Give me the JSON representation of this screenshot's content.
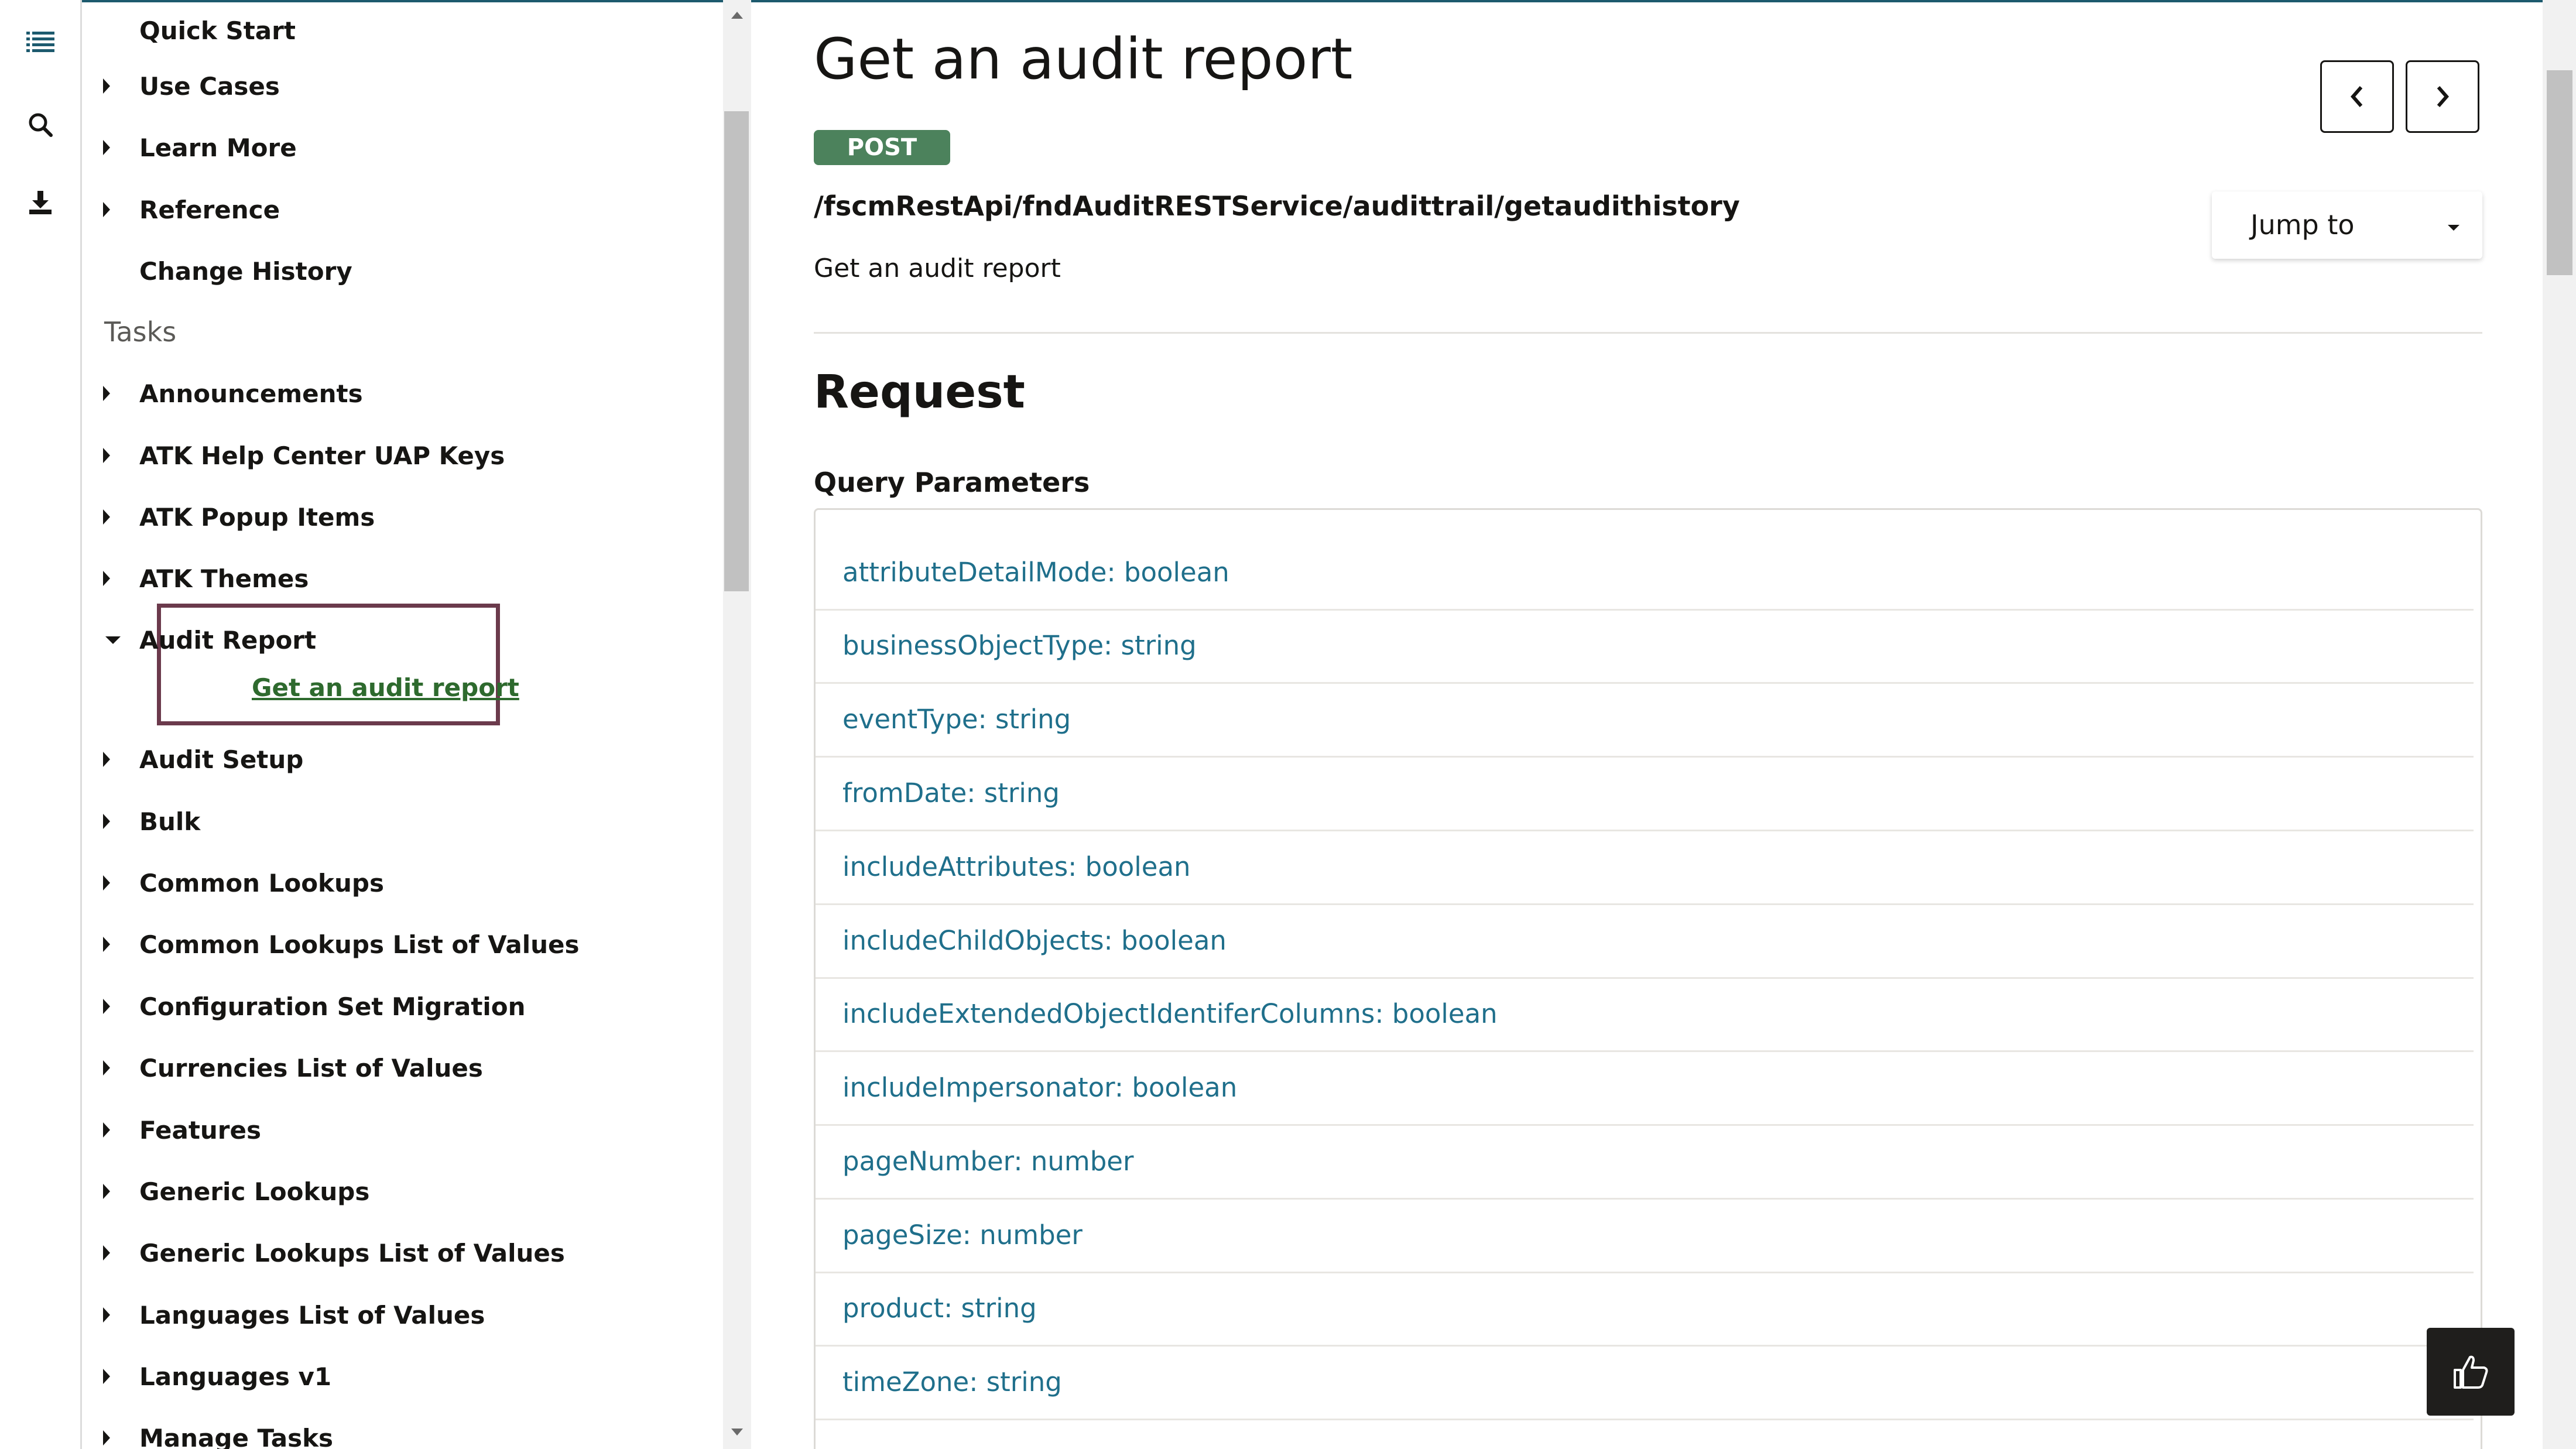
{
  "rail": {
    "icons": [
      "list-icon",
      "search-icon",
      "download-icon"
    ]
  },
  "sidebar": {
    "items_top": [
      {
        "label": "Quick Start",
        "expandable": false
      },
      {
        "label": "Use Cases",
        "expandable": true
      },
      {
        "label": "Learn More",
        "expandable": true
      },
      {
        "label": "Reference",
        "expandable": true
      },
      {
        "label": "Change History",
        "expandable": false
      }
    ],
    "section_label": "Tasks",
    "tasks": [
      {
        "label": "Announcements"
      },
      {
        "label": "ATK Help Center UAP Keys"
      },
      {
        "label": "ATK Popup Items"
      },
      {
        "label": "ATK Themes"
      },
      {
        "label": "Audit Report",
        "expanded": true
      },
      {
        "label": "Audit Setup"
      },
      {
        "label": "Bulk"
      },
      {
        "label": "Common Lookups"
      },
      {
        "label": "Common Lookups List of Values"
      },
      {
        "label": "Configuration Set Migration"
      },
      {
        "label": "Currencies List of Values"
      },
      {
        "label": "Features"
      },
      {
        "label": "Generic Lookups"
      },
      {
        "label": "Generic Lookups List of Values"
      },
      {
        "label": "Languages List of Values"
      },
      {
        "label": "Languages v1"
      },
      {
        "label": "Manage Tasks"
      }
    ],
    "active_subitem": "Get an audit report"
  },
  "main": {
    "title": "Get an audit report",
    "method": "POST",
    "endpoint": "/fscmRestApi/fndAuditRESTService/audittrail/getaudithistory",
    "description": "Get an audit report",
    "jump_to_label": "Jump to",
    "request_heading": "Request",
    "query_params_label": "Query Parameters",
    "params": [
      "attributeDetailMode: boolean",
      "businessObjectType: string",
      "eventType: string",
      "fromDate: string",
      "includeAttributes: boolean",
      "includeChildObjects: boolean",
      "includeExtendedObjectIdentiferColumns: boolean",
      "includeImpersonator: boolean",
      "pageNumber: number",
      "pageSize: number",
      "product: string",
      "timeZone: string"
    ]
  },
  "colors": {
    "post_badge": "#4c825c",
    "link": "#1f6f8b",
    "active_link": "#2e6a2e",
    "highlight_border": "#6b3a4c"
  }
}
